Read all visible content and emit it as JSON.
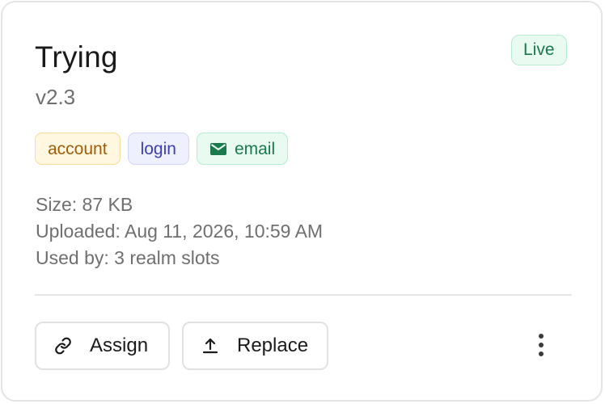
{
  "card": {
    "title": "Trying",
    "version": "v2.3",
    "status": "Live",
    "tags": [
      {
        "label": "account"
      },
      {
        "label": "login"
      },
      {
        "label": "email",
        "icon": "envelope-icon"
      }
    ],
    "meta": {
      "size": "Size: 87 KB",
      "uploaded": "Uploaded: Aug 11, 2026, 10:59 AM",
      "used_by": "Used by: 3 realm slots"
    },
    "actions": {
      "assign_label": "Assign",
      "assign_icon": "link-icon",
      "replace_label": "Replace",
      "replace_icon": "upload-icon",
      "more_icon": "more-vertical-icon"
    }
  },
  "colors": {
    "status_live": "#19794a",
    "tag_account": "#a35b06",
    "tag_login": "#3d3fb6",
    "tag_email": "#1a7a4b"
  }
}
